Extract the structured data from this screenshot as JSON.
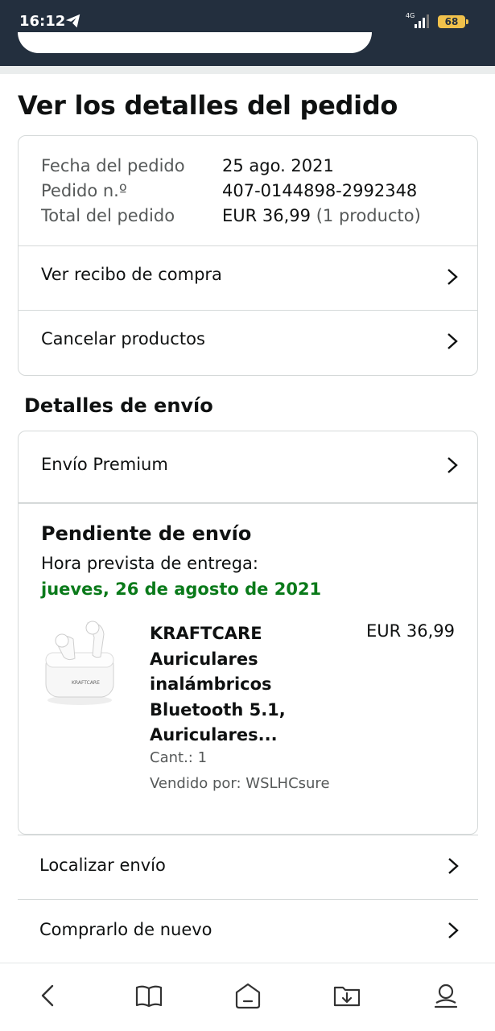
{
  "status_bar": {
    "time": "16:12",
    "network": "4G",
    "battery": "68"
  },
  "page": {
    "title": "Ver los detalles del pedido"
  },
  "order_summary": {
    "rows": [
      {
        "label": "Fecha del pedido",
        "value": "25 ago. 2021",
        "extra": ""
      },
      {
        "label": "Pedido n.º",
        "value": "407-0144898-2992348",
        "extra": ""
      },
      {
        "label": "Total del pedido",
        "value": "EUR 36,99",
        "extra": "(1 producto)"
      }
    ],
    "links": [
      {
        "label": "Ver recibo de compra"
      },
      {
        "label": "Cancelar productos"
      }
    ]
  },
  "shipping": {
    "section_title": "Detalles de envío",
    "method": "Envío Premium",
    "status": "Pendiente de envío",
    "eta_label": "Hora prevista de entrega:",
    "eta_date": "jueves, 26 de agosto de 2021",
    "product": {
      "title_lines": [
        "KRAFTCARE",
        "Auriculares",
        "inalámbricos",
        "Bluetooth 5.1,",
        "Auriculares..."
      ],
      "price": "EUR 36,99",
      "quantity": "Cant.: 1",
      "seller": "Vendido por: WSLHCsure",
      "brand_on_case": "KRAFTCARE"
    }
  },
  "actions": [
    {
      "label": "Localizar envío"
    },
    {
      "label": "Comprarlo de nuevo"
    }
  ],
  "bottom_nav": {
    "icons": [
      "back-icon",
      "book-icon",
      "home-icon",
      "download-folder-icon",
      "profile-icon"
    ]
  },
  "colors": {
    "header_bg": "#232f3e",
    "eta_green": "#0a7a1a",
    "border": "#d5d9d9",
    "battery": "#f0c14b"
  }
}
